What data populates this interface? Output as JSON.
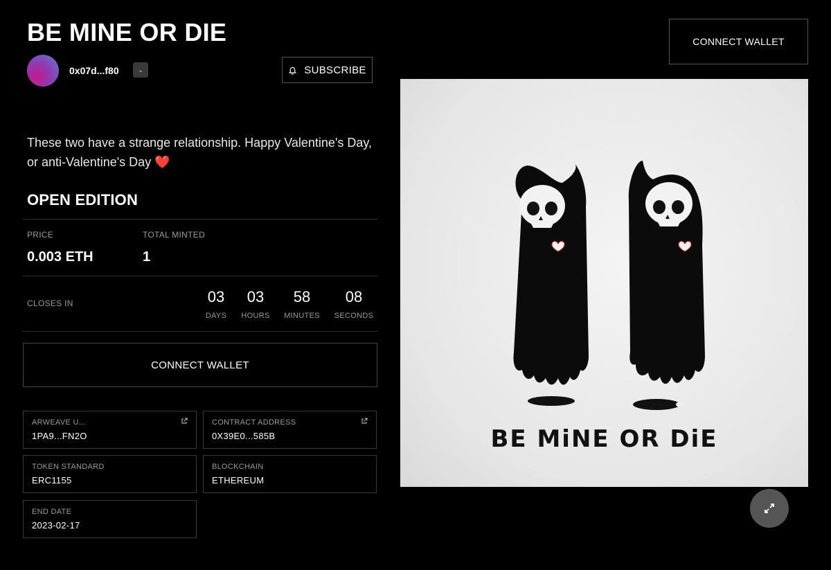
{
  "title": "BE MINE OR DIE",
  "creator": {
    "address": "0x07d...f80",
    "menu_glyph": "⌄",
    "avatar_icon": "avatar-gradient"
  },
  "subscribe": {
    "label": "SUBSCRIBE",
    "icon": "bell-icon"
  },
  "header": {
    "connect_label": "CONNECT WALLET"
  },
  "description": "These two have a strange relationship. Happy Valentine's Day, or anti-Valentine's Day",
  "description_emoji": "❤️",
  "edition": {
    "title": "OPEN EDITION"
  },
  "price": {
    "label": "PRICE",
    "value": "0.003 ETH"
  },
  "minted": {
    "label": "TOTAL MINTED",
    "value": "1"
  },
  "closes": {
    "label": "CLOSES IN",
    "units": [
      {
        "value": "03",
        "unit": "DAYS"
      },
      {
        "value": "03",
        "unit": "HOURS"
      },
      {
        "value": "58",
        "unit": "MINUTES"
      },
      {
        "value": "08",
        "unit": "SECONDS"
      }
    ]
  },
  "main": {
    "connect_label": "CONNECT WALLET"
  },
  "details": [
    {
      "key": "ARWEAVE U...",
      "value": "1PA9...FN2O",
      "external": true
    },
    {
      "key": "CONTRACT ADDRESS",
      "value": "0X39E0...585B",
      "external": true
    },
    {
      "key": "TOKEN STANDARD",
      "value": "ERC1155",
      "external": false
    },
    {
      "key": "BLOCKCHAIN",
      "value": "ETHEREUM",
      "external": false
    },
    {
      "key": "END DATE",
      "value": "2023-02-17",
      "external": false
    }
  ],
  "artwork": {
    "caption": "BE MiNE OR DiE"
  },
  "colors": {
    "background": "#000000",
    "border": "#444444",
    "muted": "#9a9a9a",
    "accent": "#e0243a"
  }
}
